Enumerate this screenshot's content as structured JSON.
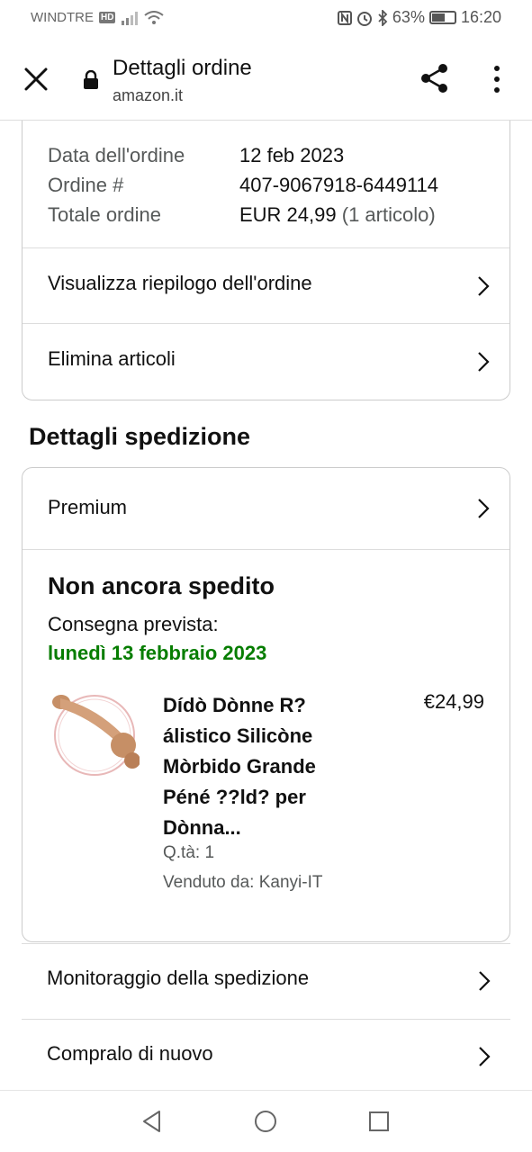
{
  "status_bar": {
    "carrier": "WINDTRE",
    "network_badge": "HD",
    "battery_percent": "63%",
    "battery_level": 0.63,
    "time": "16:20",
    "icons": [
      "signal-icon",
      "wifi-icon",
      "nfc-icon",
      "alarm-icon",
      "bluetooth-icon",
      "battery-icon"
    ]
  },
  "browser_bar": {
    "title": "Dettagli ordine",
    "domain": "amazon.it",
    "icons": [
      "close-icon",
      "lock-icon",
      "share-icon",
      "more-vert-icon"
    ]
  },
  "order_summary": {
    "date_label": "Data dell'ordine",
    "date_value": "12 feb 2023",
    "number_label": "Ordine #",
    "number_value": "407-9067918-6449114",
    "total_label": "Totale ordine",
    "total_value": "EUR 24,99",
    "total_items": "(1 articolo)",
    "links": [
      {
        "label": "Visualizza riepilogo dell'ordine"
      },
      {
        "label": "Elimina articoli"
      }
    ]
  },
  "shipping": {
    "section_title": "Dettagli spedizione",
    "shipping_option": "Premium",
    "status": "Non ancora spedito",
    "delivery_label": "Consegna prevista:",
    "delivery_date": "lunedì 13 febbraio 2023",
    "delivery_date_color": "#067d00",
    "item": {
      "title": "Dídò Dònne R? álistico Silicòne Mòrbido Grande Péné ??ld? per Dònna...",
      "price": "€24,99",
      "quantity": "Q.tà: 1",
      "seller": "Venduto da: Kanyi-IT"
    }
  },
  "actions": [
    {
      "label": "Monitoraggio della spedizione"
    },
    {
      "label": "Compralo di nuovo"
    }
  ],
  "nav_bar": {
    "icons": [
      "back-icon",
      "home-icon",
      "recents-icon"
    ]
  }
}
